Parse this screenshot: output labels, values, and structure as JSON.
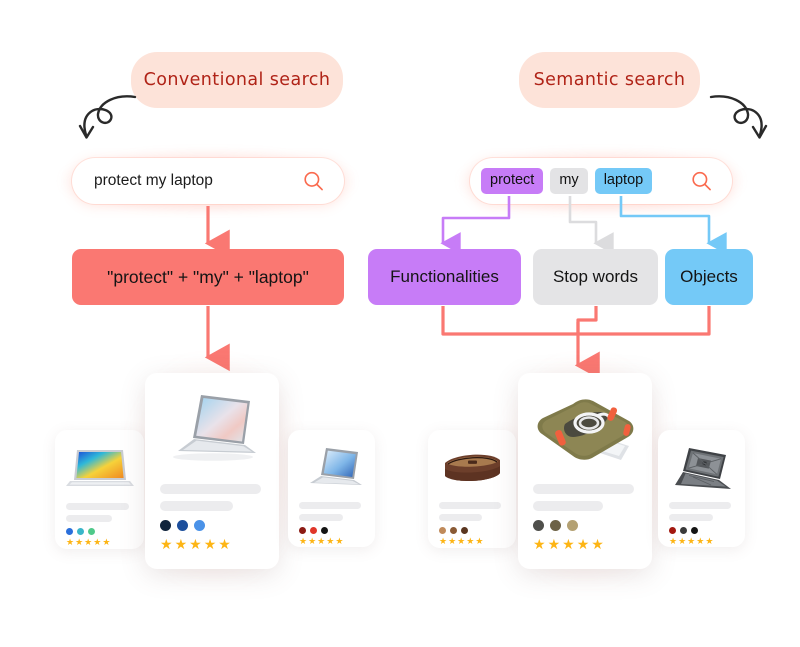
{
  "left": {
    "title": "Conventional search",
    "search": {
      "value": "protect my laptop",
      "placeholder": "Search",
      "icon": "search-icon"
    },
    "query_box": "\"protect\" + \"my\" + \"laptop\"",
    "results": [
      {
        "name": "laptop-colorful-screen",
        "size": "small",
        "dots": [
          "#2a6fdb",
          "#3ab6c9",
          "#4fc98a"
        ],
        "stars": 5
      },
      {
        "name": "laptop-silver-surface",
        "size": "big",
        "dots": [
          "#10243c",
          "#1d4f9c",
          "#4a92e8"
        ],
        "stars": 5
      },
      {
        "name": "laptop-windows-bloom",
        "size": "small",
        "dots": [
          "#8c1b14",
          "#e0362a",
          "#141414"
        ],
        "stars": 5
      }
    ]
  },
  "right": {
    "title": "Semantic search",
    "search": {
      "placeholder": "Search",
      "icon": "search-icon",
      "tokens": [
        {
          "text": "protect",
          "class": "purple",
          "color": "#c77cf7"
        },
        {
          "text": "my",
          "class": "gray",
          "color": "#e3e3e5"
        },
        {
          "text": "laptop",
          "class": "blue",
          "color": "#74c9f7"
        }
      ]
    },
    "categories": [
      {
        "label": "Functionalities",
        "color": "#c77cf7"
      },
      {
        "label": "Stop words",
        "color": "#e4e4e6"
      },
      {
        "label": "Objects",
        "color": "#74c9f7"
      }
    ],
    "results": [
      {
        "name": "brown-leather-sleeve",
        "size": "small",
        "dots": [
          "#c08a5a",
          "#8a5a35",
          "#5a3620"
        ],
        "stars": 5
      },
      {
        "name": "olive-laptop-sleeve",
        "size": "big",
        "dots": [
          "#4f4f4b",
          "#6d6246",
          "#b4a173"
        ],
        "stars": 5
      },
      {
        "name": "black-rugged-case",
        "size": "small",
        "dots": [
          "#a31810",
          "#3a3a3a",
          "#141414"
        ],
        "stars": 5
      }
    ]
  },
  "colors": {
    "accent": "#fa7872",
    "connector": "#ff7a60",
    "title_pill_bg": "#fde3d9",
    "title_text": "#b02317",
    "purple": "#c77cf7",
    "gray": "#e4e4e6",
    "blue": "#74c9f7",
    "star": "#fdb515"
  }
}
